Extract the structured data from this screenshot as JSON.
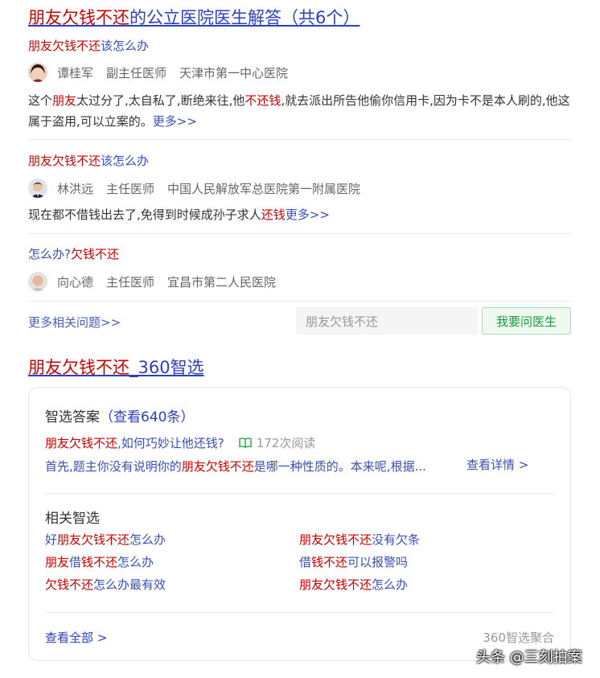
{
  "result1": {
    "title_hl": "朋友欠钱不还",
    "title_rest": "的公立医院医生解答（共6个）",
    "qas": [
      {
        "question_hl": "朋友欠钱不还",
        "question_rest": "该怎么办",
        "doctor": {
          "name": "谭桂军",
          "title": "副主任医师",
          "hospital": "天津市第一中心医院"
        },
        "answer": [
          {
            "t": "这个",
            "hl": false
          },
          {
            "t": "朋友",
            "hl": true
          },
          {
            "t": "太过分了,太自私了,断绝来往,他",
            "hl": false
          },
          {
            "t": "不还钱",
            "hl": true
          },
          {
            "t": ",就去派出所告他偷你信用卡,因为卡不是本人刷的,他这属于盗用,可以立案的。",
            "hl": false
          }
        ],
        "more": "更多>>"
      },
      {
        "question_hl": "朋友欠钱不还",
        "question_rest": "该怎么办",
        "doctor": {
          "name": "林洪远",
          "title": "主任医师",
          "hospital": "中国人民解放军总医院第一附属医院"
        },
        "answer": [
          {
            "t": "现在都不借钱出去了,免得到时候成孙子求人",
            "hl": false
          },
          {
            "t": "还钱",
            "hl": true
          }
        ],
        "more": "更多>>"
      },
      {
        "question_pre": "怎么办?",
        "question_hl": "欠钱不还",
        "doctor": {
          "name": "向心德",
          "title": "主任医师",
          "hospital": "宜昌市第二人民医院"
        }
      }
    ],
    "more_related": "更多相关问题>>",
    "ask_input_value": "朋友欠钱不还",
    "ask_button": "我要问医生"
  },
  "result2": {
    "title_hl": "朋友欠钱不还",
    "title_rest": "_360智选",
    "card": {
      "answers_label": "智选答案",
      "answers_count": "（查看640条）",
      "question_hl": "朋友欠钱不还",
      "question_rest": ",如何巧妙让他还钱?",
      "reads": "172次阅读",
      "snippet_pre": "首先,题主你没有说明你的",
      "snippet_hl": "朋友欠钱不还",
      "snippet_post": "是哪一种性质的。本来呢,根据...",
      "detail": "查看详情 >",
      "related_label": "相关智选",
      "related": [
        [
          {
            "t": "好",
            "hl": false
          },
          {
            "t": "朋友欠钱不还",
            "hl": true
          },
          {
            "t": "怎么办",
            "hl": false
          }
        ],
        [
          {
            "t": "朋友欠钱不还",
            "hl": true
          },
          {
            "t": "没有欠条",
            "hl": false
          }
        ],
        [
          {
            "t": "朋友",
            "hl": true
          },
          {
            "t": "借",
            "hl": false
          },
          {
            "t": "钱不还",
            "hl": true
          },
          {
            "t": "怎么办",
            "hl": false
          }
        ],
        [
          {
            "t": "借",
            "hl": false
          },
          {
            "t": "钱不还",
            "hl": true
          },
          {
            "t": "可以报警吗",
            "hl": false
          }
        ],
        [
          {
            "t": "欠钱不还",
            "hl": true
          },
          {
            "t": "怎么办最有效",
            "hl": false
          }
        ],
        [
          {
            "t": "朋友欠钱不还",
            "hl": true
          },
          {
            "t": "怎么办",
            "hl": false
          }
        ]
      ],
      "view_all": "查看全部 >",
      "aggregator": "360智选聚合"
    }
  },
  "watermark": "头条 @三刻拍案",
  "colors": {
    "highlight": "#cc0000",
    "link": "#2a3fc2",
    "green_button": "#1f9a3a"
  }
}
